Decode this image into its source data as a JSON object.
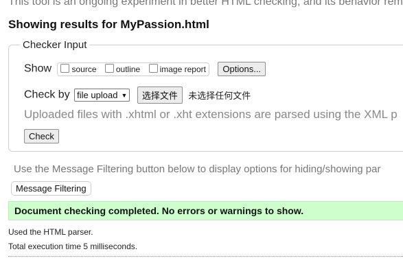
{
  "intro_text": "This tool is an ongoing experiment in better HTML checking, and its behavior rem",
  "results_heading": "Showing results for MyPassion.html",
  "checker_input": {
    "legend": "Checker Input",
    "show_label": "Show",
    "checkboxes": [
      {
        "label": "source",
        "checked": false
      },
      {
        "label": "outline",
        "checked": false
      },
      {
        "label": "image report",
        "checked": false
      }
    ],
    "options_button": "Options...",
    "check_by_label": "Check by",
    "check_by_select": "file upload",
    "file_button": "选择文件",
    "no_file_text": "未选择任何文件",
    "upload_note": "Uploaded files with .xhtml or .xht extensions are parsed using the XML p",
    "check_button": "Check"
  },
  "filter_hint": "Use the Message Filtering button below to display options for hiding/showing par",
  "message_filtering_button": "Message Filtering",
  "result_message": "Document checking completed. No errors or warnings to show.",
  "parser_info": "Used the HTML parser.",
  "execution_time": "Total execution time 5 milliseconds.",
  "colors": {
    "success_background": "#ccffcc",
    "muted_text": "#888888"
  }
}
